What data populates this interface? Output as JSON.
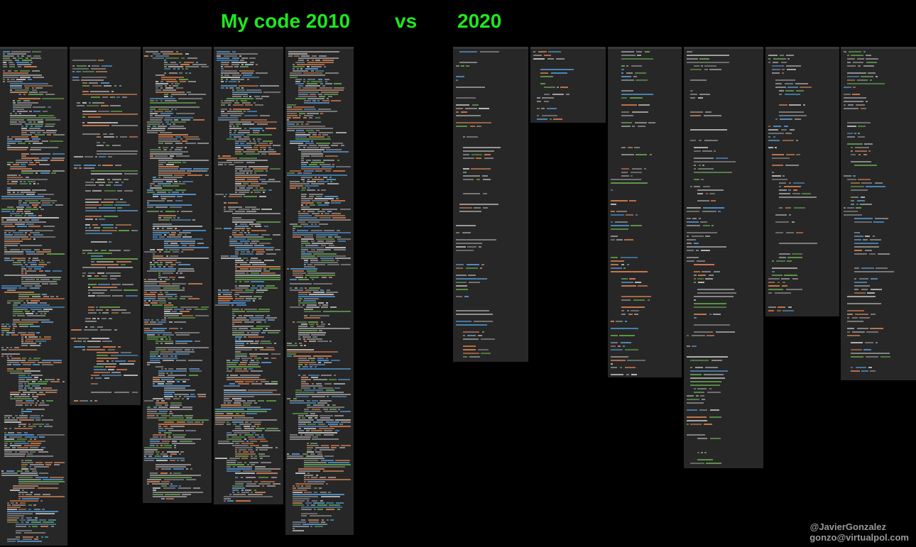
{
  "title": {
    "left": "My code 2010",
    "middle": "vs",
    "right": "2020",
    "color": "#1ee81e"
  },
  "credits": {
    "handle": "@JavierGonzalez",
    "email": "gonzo@virtualpol.com"
  },
  "syntax_colors": {
    "default": "#8a8a8a",
    "keyword": "#c8794a",
    "identifier": "#4f8fc6",
    "comment": "#5f9a4a",
    "string": "#b8b8b8"
  }
}
